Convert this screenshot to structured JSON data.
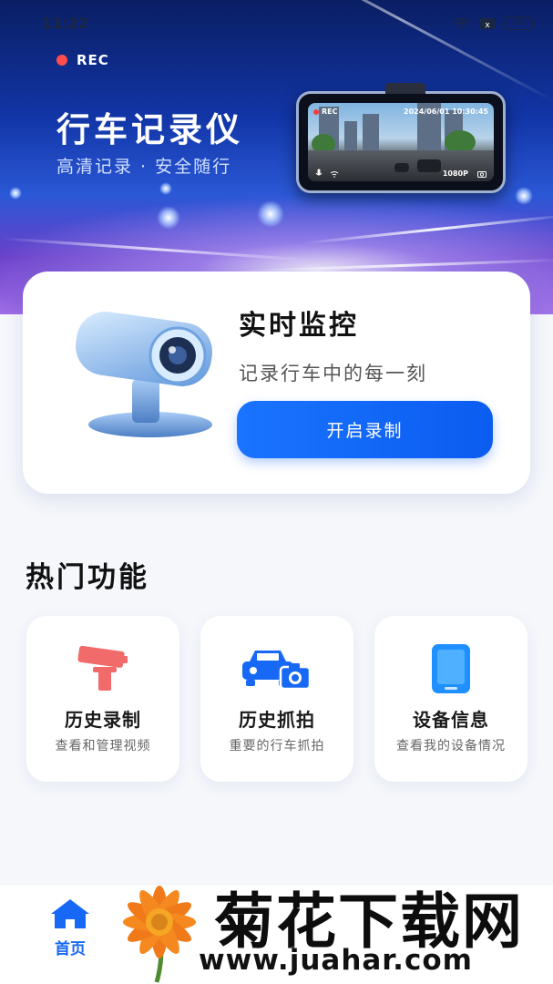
{
  "status_bar": {
    "time": "11:22",
    "battery": "100"
  },
  "hero": {
    "rec_label": "REC",
    "title": "行车记录仪",
    "subtitle": "高清记录 · 安全随行",
    "device": {
      "rec_label": "REC",
      "datetime": "2024/06/01 10:30:45",
      "resolution": "1080P"
    }
  },
  "monitor": {
    "title": "实时监控",
    "description": "记录行车中的每一刻",
    "button_label": "开启录制"
  },
  "features": {
    "section_title": "热门功能",
    "items": [
      {
        "title": "历史录制",
        "description": "查看和管理视频",
        "icon": "cctv-camera-icon",
        "color": "#f26b6b"
      },
      {
        "title": "历史抓拍",
        "description": "重要的行车抓拍",
        "icon": "car-camera-icon",
        "color": "#1769f5"
      },
      {
        "title": "设备信息",
        "description": "查看我的设备情况",
        "icon": "phone-device-icon",
        "color": "#1e90ff"
      }
    ]
  },
  "bottom_nav": {
    "home_label": "首页",
    "accent": "#1769f5"
  },
  "watermark": {
    "text": "菊花下载网",
    "url": "www.juahar.com"
  }
}
